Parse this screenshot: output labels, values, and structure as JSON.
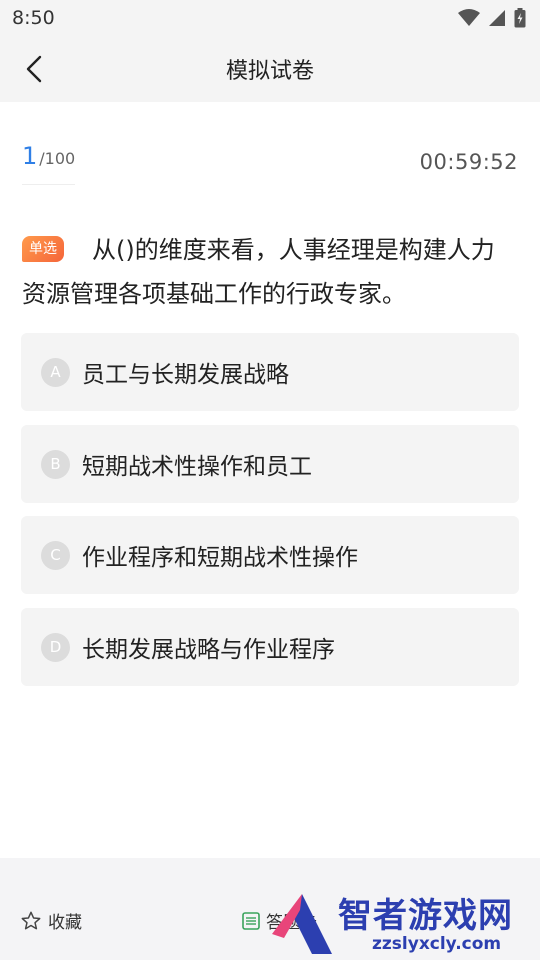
{
  "status_bar": {
    "time": "8:50"
  },
  "header": {
    "title": "模拟试卷"
  },
  "progress": {
    "current": "1",
    "total": "/100"
  },
  "timer": "00:59:52",
  "question": {
    "type": "单选",
    "text": "从()的维度来看，人事经理是构建人力资源管理各项基础工作的行政专家。"
  },
  "options": [
    {
      "letter": "A",
      "text": "员工与长期发展战略"
    },
    {
      "letter": "B",
      "text": "短期战术性操作和员工"
    },
    {
      "letter": "C",
      "text": "作业程序和短期战术性操作"
    },
    {
      "letter": "D",
      "text": "长期发展战略与作业程序"
    }
  ],
  "bottom_bar": {
    "favorite_label": "收藏",
    "answer_sheet_label": "答题卡"
  },
  "watermark": {
    "text": "智者游戏网",
    "domain": "zzslyxcly.com"
  },
  "colors": {
    "accent": "#2f7fe6",
    "badge": "#f5653a",
    "option_bg": "#f4f4f4"
  }
}
